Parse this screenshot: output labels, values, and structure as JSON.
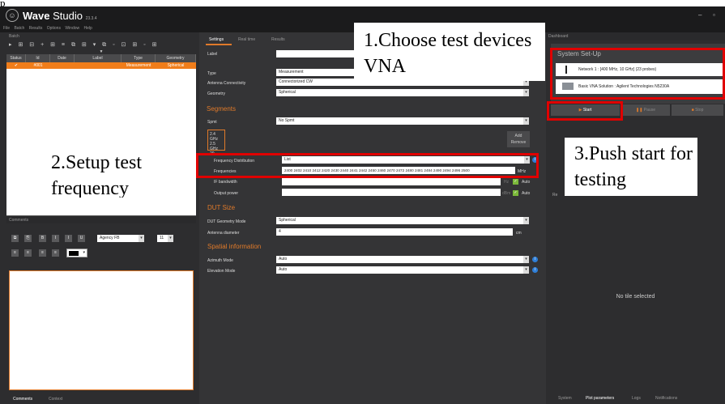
{
  "app": {
    "name": "Wave",
    "name2": "Studio",
    "version": "23.3.4",
    "window_controls": [
      "–",
      "▫"
    ]
  },
  "top_cutoff_text": "p",
  "menu": [
    "File",
    "Batch",
    "Results",
    "Options",
    "Window",
    "Help"
  ],
  "batch_panel": {
    "title": "Batch",
    "columns": [
      "Status",
      "Id",
      "Date",
      "Label",
      "Type",
      "Geometry"
    ],
    "rows": [
      {
        "status": "✔",
        "id": "#001",
        "date": "",
        "label": "",
        "type": "Measurement",
        "geometry": "Spherical"
      }
    ]
  },
  "comments_panel": {
    "title": "Comments",
    "font": "Agency FB",
    "font_size": "11",
    "tabs": [
      "Comments",
      "Context"
    ]
  },
  "center": {
    "tabs": [
      "Settings",
      "Real time",
      "Results"
    ],
    "label_field": {
      "label": "Label",
      "value": ""
    },
    "type": {
      "label": "Type",
      "value": "Measurement"
    },
    "antenna_connectivity": {
      "label": "Antenna Connectivity",
      "value": "Connectorized CW"
    },
    "geometry": {
      "label": "Geometry",
      "value": "Spherical"
    },
    "segments_title": "Segments",
    "spmt": {
      "label": "Spmt",
      "value": "No Spmt"
    },
    "segment_list": [
      "2.4 GHz",
      "2.5 GHz",
      "20"
    ],
    "add_remove": [
      "Add",
      "Remove"
    ],
    "freq_distribution": {
      "label": "Frequency Distribution",
      "value": "List"
    },
    "frequencies": {
      "label": "Frequencies",
      "value": "2400 2402 2410 2412 2420 2430 2440 2441 2442 2450 2460 2470 2472 2480 2481 2484 2490 2494 2496 2500",
      "unit": "MHz"
    },
    "if_bandwidth": {
      "label": "IF bandwidth",
      "unit": "Hz",
      "auto": "Auto"
    },
    "output_power": {
      "label": "Output power",
      "unit": "dBm",
      "auto": "Auto"
    },
    "dut_title": "DUT Size",
    "dut_geometry": {
      "label": "DUT Geometry Mode",
      "value": "Spherical"
    },
    "antenna_diameter": {
      "label": "Antenna diameter",
      "value": "4",
      "unit": "cm"
    },
    "spatial_title": "Spatial information",
    "azimuth": {
      "label": "Azimuth Mode",
      "value": "Auto"
    },
    "elevation": {
      "label": "Elevation Mode",
      "value": "Auto"
    }
  },
  "dashboard": {
    "title": "Dashboard",
    "system_setup": "System Set-Up",
    "network": "Network 1 : [400 MHz, 10 GHz] (23 probes)",
    "vna": "Basic VNA Solution : Agilent Technologies N5230A",
    "start": "Start",
    "pause": "Pause",
    "stop": "Stop",
    "re_label": "Re",
    "no_tile": "No tile selected",
    "bottom_tabs": [
      "System",
      "Plot parameters",
      "Logs",
      "Notifications"
    ]
  },
  "annotations": {
    "a1": "1.Choose test devices VNA",
    "a2_line1": "2.Setup test",
    "a2_line2": "frequency",
    "a3": "3.Push start for testing"
  },
  "colors": {
    "accent": "#f07d1a",
    "highlight": "#e00000",
    "panel": "#2d2d2f",
    "dark": "#1b1b1c"
  }
}
